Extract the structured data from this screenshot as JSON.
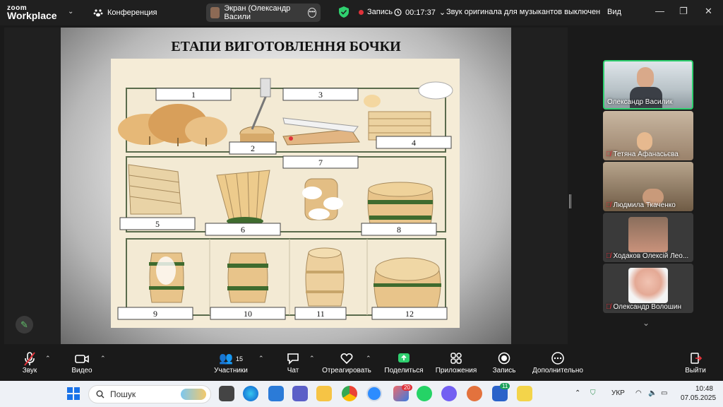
{
  "titlebar": {
    "logo_top": "zoom",
    "logo_bottom": "Workplace",
    "conference": "Конференция",
    "screen_share": "Экран (Олександр Васили",
    "recording": "Запись",
    "timer": "00:17:37",
    "original_sound": "Звук оригинала для музыкантов выключен",
    "view": "Вид"
  },
  "slide": {
    "title": "ЕТАПИ ВИГОТОВЛЕННЯ БОЧКИ",
    "stage_labels": [
      "1",
      "2",
      "3",
      "4",
      "5",
      "6",
      "7",
      "8",
      "9",
      "10",
      "11",
      "12"
    ]
  },
  "participants": [
    {
      "name": "Олександр Василик",
      "muted": false
    },
    {
      "name": "Тетяна Афанасьєва",
      "muted": true
    },
    {
      "name": "Людмила Ткаченко",
      "muted": true
    },
    {
      "name": "Ходаков Олексій Лео...",
      "muted": true
    },
    {
      "name": "Олександр Волошин",
      "muted": true
    }
  ],
  "toolbar": {
    "audio": "Звук",
    "video": "Видео",
    "participants": "Участники",
    "participants_count": "15",
    "chat": "Чат",
    "react": "Отреагировать",
    "share": "Поделиться",
    "apps": "Приложения",
    "record": "Запись",
    "more": "Дополнительно",
    "leave": "Выйти"
  },
  "taskbar": {
    "search_placeholder": "Пошук",
    "badge_count": "11",
    "badge_mail": "20",
    "language": "УКР",
    "time": "10:48",
    "date": "07.05.2025"
  },
  "colors": {
    "accent_green": "#2fd06f",
    "record_red": "#e0323a",
    "barrel_wood": "#e8c48a",
    "hoop_green": "#3f6b2e"
  }
}
